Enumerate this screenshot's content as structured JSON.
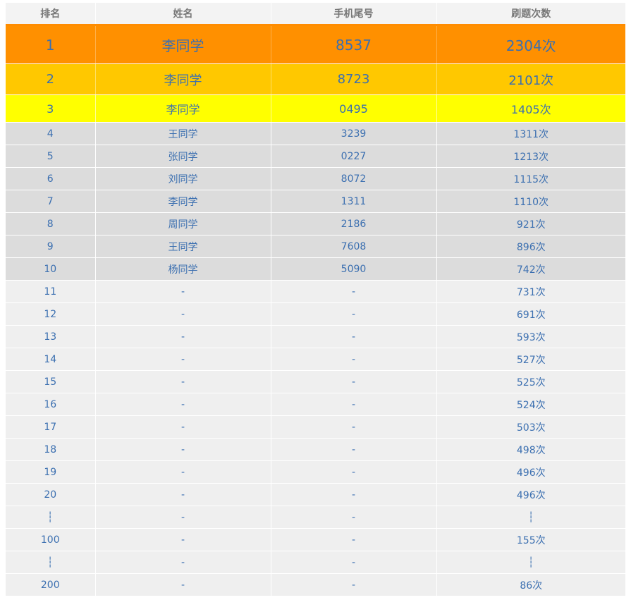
{
  "colors": {
    "gold": "#ff9000",
    "silver": "#ffc800",
    "bronze": "#ffff00",
    "header_accent": "#ff8c00",
    "text": "#3b6fb0"
  },
  "columns": [
    "排名",
    "姓名",
    "手机尾号",
    "刷题次数"
  ],
  "rows": [
    {
      "rank": "1",
      "name": "李同学",
      "phone": "8537",
      "count": "2304次",
      "tier": "gold"
    },
    {
      "rank": "2",
      "name": "李同学",
      "phone": "8723",
      "count": "2101次",
      "tier": "silver"
    },
    {
      "rank": "3",
      "name": "李同学",
      "phone": "0495",
      "count": "1405次",
      "tier": "bronze"
    },
    {
      "rank": "4",
      "name": "王同学",
      "phone": "3239",
      "count": "1311次",
      "tier": "top"
    },
    {
      "rank": "5",
      "name": "张同学",
      "phone": "0227",
      "count": "1213次",
      "tier": "top"
    },
    {
      "rank": "6",
      "name": "刘同学",
      "phone": "8072",
      "count": "1115次",
      "tier": "top"
    },
    {
      "rank": "7",
      "name": "李同学",
      "phone": "1311",
      "count": "1110次",
      "tier": "top"
    },
    {
      "rank": "8",
      "name": "周同学",
      "phone": "2186",
      "count": "921次",
      "tier": "top"
    },
    {
      "rank": "9",
      "name": "王同学",
      "phone": "7608",
      "count": "896次",
      "tier": "top"
    },
    {
      "rank": "10",
      "name": "杨同学",
      "phone": "5090",
      "count": "742次",
      "tier": "top"
    },
    {
      "rank": "11",
      "name": "-",
      "phone": "-",
      "count": "731次",
      "tier": "rest"
    },
    {
      "rank": "12",
      "name": "-",
      "phone": "-",
      "count": "691次",
      "tier": "rest"
    },
    {
      "rank": "13",
      "name": "-",
      "phone": "-",
      "count": "593次",
      "tier": "rest"
    },
    {
      "rank": "14",
      "name": "-",
      "phone": "-",
      "count": "527次",
      "tier": "rest"
    },
    {
      "rank": "15",
      "name": "-",
      "phone": "-",
      "count": "525次",
      "tier": "rest"
    },
    {
      "rank": "16",
      "name": "-",
      "phone": "-",
      "count": "524次",
      "tier": "rest"
    },
    {
      "rank": "17",
      "name": "-",
      "phone": "-",
      "count": "503次",
      "tier": "rest"
    },
    {
      "rank": "18",
      "name": "-",
      "phone": "-",
      "count": "498次",
      "tier": "rest"
    },
    {
      "rank": "19",
      "name": "-",
      "phone": "-",
      "count": "496次",
      "tier": "rest"
    },
    {
      "rank": "20",
      "name": "-",
      "phone": "-",
      "count": "496次",
      "tier": "rest"
    },
    {
      "rank": "┆",
      "name": "-",
      "phone": "-",
      "count": "┆",
      "tier": "rest"
    },
    {
      "rank": "100",
      "name": "-",
      "phone": "-",
      "count": "155次",
      "tier": "rest"
    },
    {
      "rank": "┆",
      "name": "-",
      "phone": "-",
      "count": "┆",
      "tier": "rest"
    },
    {
      "rank": "200",
      "name": "-",
      "phone": "-",
      "count": "86次",
      "tier": "rest"
    }
  ]
}
